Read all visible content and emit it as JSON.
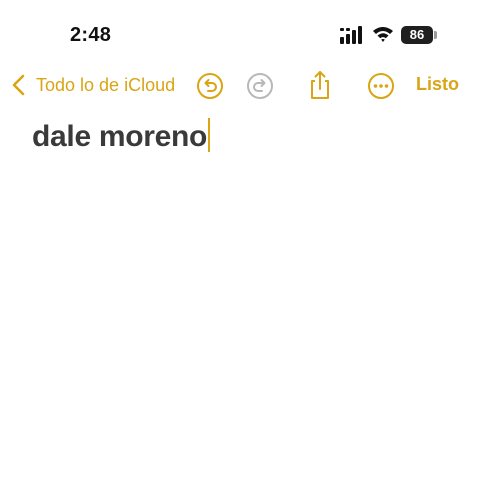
{
  "status_bar": {
    "time": "2:48",
    "battery_level": "86"
  },
  "nav": {
    "back_label": "Todo lo de iCloud",
    "done_label": "Listo"
  },
  "note": {
    "text": "dale moreno"
  },
  "colors": {
    "accent": "#d9a514",
    "disabled_icon": "#b8b8b8",
    "text": "#3a3a3a"
  },
  "icons": [
    "signal-icon",
    "wifi-icon",
    "chevron-left-icon",
    "undo-icon",
    "redo-icon",
    "share-icon",
    "more-icon"
  ]
}
